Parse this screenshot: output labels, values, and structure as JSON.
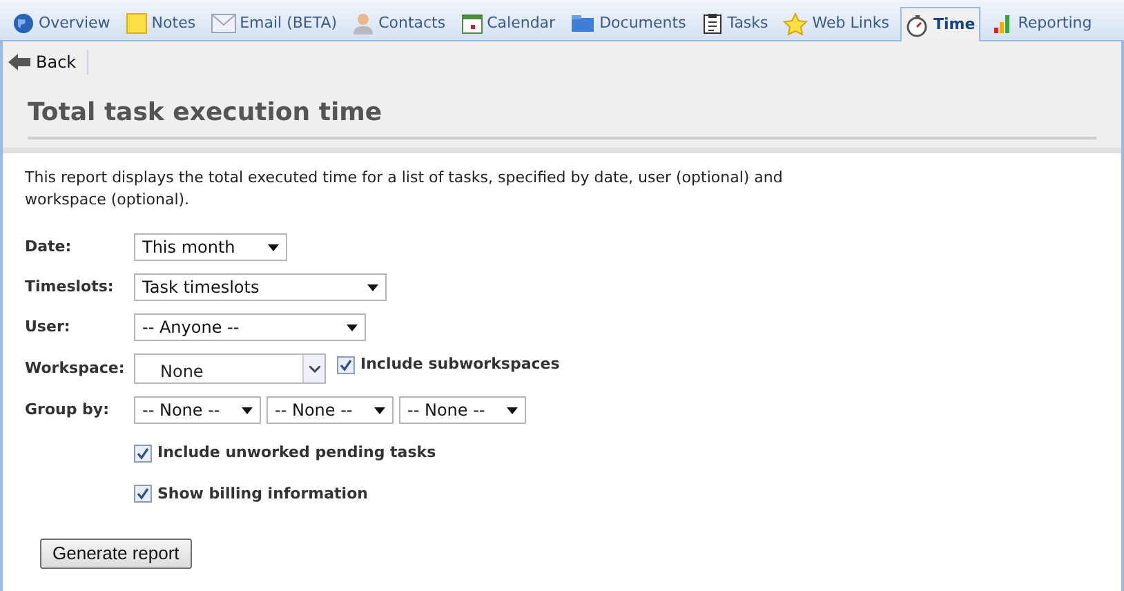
{
  "tabs": [
    {
      "label": "Overview",
      "selected": false
    },
    {
      "label": "Notes",
      "selected": false
    },
    {
      "label": "Email (BETA)",
      "selected": false
    },
    {
      "label": "Contacts",
      "selected": false
    },
    {
      "label": "Calendar",
      "selected": false
    },
    {
      "label": "Documents",
      "selected": false
    },
    {
      "label": "Tasks",
      "selected": false
    },
    {
      "label": "Web Links",
      "selected": false
    },
    {
      "label": "Time",
      "selected": true
    },
    {
      "label": "Reporting",
      "selected": false
    }
  ],
  "toolbar": {
    "back": "Back"
  },
  "title": "Total task execution time",
  "description": "This report displays the total executed time for a list of tasks, specified by date, user (optional) and workspace (optional).",
  "form": {
    "date": {
      "label": "Date:",
      "value": "This month"
    },
    "timeslots": {
      "label": "Timeslots:",
      "value": "Task timeslots"
    },
    "user": {
      "label": "User:",
      "value": "-- Anyone --"
    },
    "workspace": {
      "label": "Workspace:",
      "value": "None",
      "subworkspaces": {
        "label": "Include subworkspaces",
        "checked": true
      }
    },
    "group_by": {
      "label": "Group by:",
      "values": [
        "-- None --",
        "-- None --",
        "-- None --"
      ]
    },
    "options": [
      {
        "label": "Include unworked pending tasks",
        "checked": true
      },
      {
        "label": "Show billing information",
        "checked": true
      }
    ]
  },
  "button": "Generate report"
}
